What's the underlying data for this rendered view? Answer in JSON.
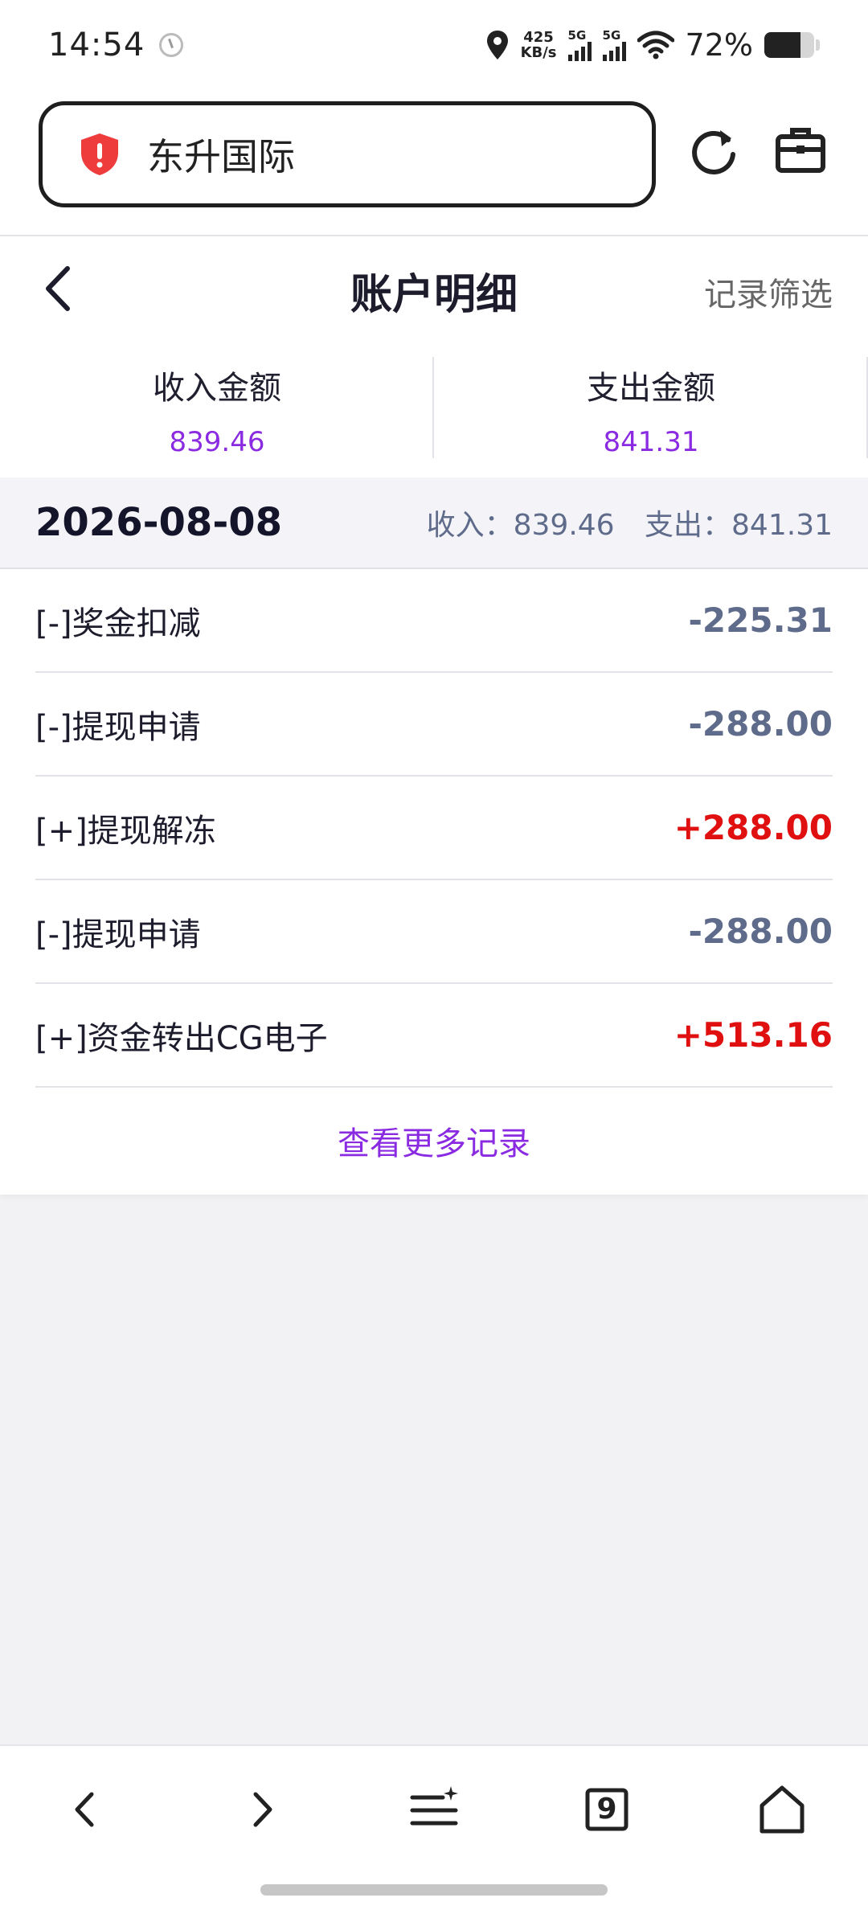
{
  "status_bar": {
    "time": "14:54",
    "speed_value": "425",
    "speed_unit": "KB/s",
    "signal1_label": "5G",
    "signal2_label": "5G",
    "battery_text": "72%",
    "battery_level": 0.72
  },
  "url_bar": {
    "site_title": "东升国际",
    "security_icon": "shield-alert-icon",
    "refresh_icon": "refresh-icon",
    "toolbox_icon": "briefcase-icon"
  },
  "header": {
    "title": "账户明细",
    "filter_label": "记录筛选",
    "back_icon": "chevron-left-icon"
  },
  "summary": {
    "income_label": "收入金额",
    "income_value": "839.46",
    "expense_label": "支出金额",
    "expense_value": "841.31"
  },
  "date_group": {
    "date": "2026-08-08",
    "income_text": "收入：839.46",
    "expense_text": "支出：841.31"
  },
  "records": [
    {
      "label": "[-]奖金扣减",
      "amount": "-225.31",
      "kind": "neg"
    },
    {
      "label": "[-]提现申请",
      "amount": "-288.00",
      "kind": "neg"
    },
    {
      "label": "[+]提现解冻",
      "amount": "+288.00",
      "kind": "pos"
    },
    {
      "label": "[-]提现申请",
      "amount": "-288.00",
      "kind": "neg"
    },
    {
      "label": "[+]资金转出CG电子",
      "amount": "+513.16",
      "kind": "pos"
    }
  ],
  "more_label": "查看更多记录",
  "colors": {
    "accent": "#8a2be2",
    "positive": "#e01010",
    "negative": "#5f6b8a"
  },
  "bottom_nav": {
    "tab_count": "9",
    "icons": [
      "back-icon",
      "forward-icon",
      "menu-icon",
      "tabs-icon",
      "home-icon"
    ]
  }
}
